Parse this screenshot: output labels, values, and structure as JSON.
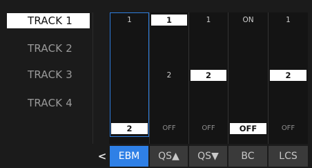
{
  "tracks": [
    {
      "label": "TRACK 1",
      "active": true
    },
    {
      "label": "TRACK 2",
      "active": false
    },
    {
      "label": "TRACK 3",
      "active": false
    },
    {
      "label": "TRACK 4",
      "active": false
    }
  ],
  "grid": {
    "row1": [
      "1",
      "1",
      "1",
      "ON",
      "1"
    ],
    "row3": [
      "",
      "2",
      "2",
      "",
      "2"
    ],
    "bottom": [
      "2",
      "OFF",
      "OFF",
      "OFF",
      "OFF"
    ]
  },
  "tabs": {
    "back_icon": "chevron-left-icon",
    "back_glyph": "<",
    "items": [
      {
        "label": "EBM",
        "active": true
      },
      {
        "label": "QS▲",
        "active": false
      },
      {
        "label": "QS▼",
        "active": false
      },
      {
        "label": "BC",
        "active": false
      },
      {
        "label": "LCS",
        "active": false
      }
    ]
  },
  "colors": {
    "accent": "#2f80e6",
    "background": "#1b1b1b"
  }
}
